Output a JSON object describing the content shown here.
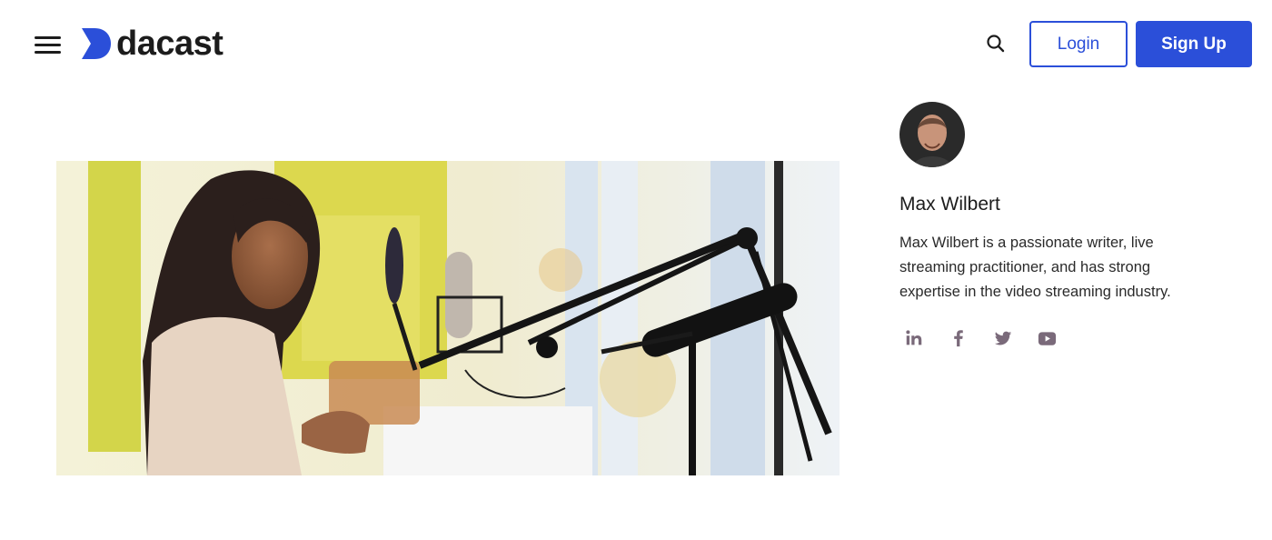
{
  "header": {
    "menu_icon": "hamburger-menu-icon",
    "logo_text": "dacast",
    "search_icon": "search-icon",
    "login_label": "Login",
    "signup_label": "Sign Up",
    "brand_color": "#2b4fd9"
  },
  "hero": {
    "image_subject": "hero-image"
  },
  "author": {
    "name": "Max Wilbert",
    "bio": "Max Wilbert is a passionate writer, live streaming practitioner, and has strong expertise in the video streaming industry.",
    "socials": [
      {
        "icon": "linkedin-icon"
      },
      {
        "icon": "facebook-icon"
      },
      {
        "icon": "twitter-icon"
      },
      {
        "icon": "youtube-icon"
      }
    ],
    "social_color": "#7a6a7a"
  }
}
